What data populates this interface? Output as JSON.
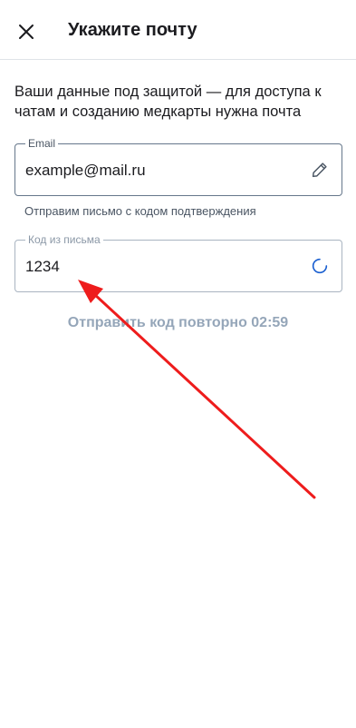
{
  "header": {
    "title": "Укажите почту",
    "close_icon": "close-icon"
  },
  "intro_text": "Ваши данные под защитой — для доступа к чатам и созданию медкарты нужна почта",
  "email_field": {
    "label": "Email",
    "value": "example@mail.ru",
    "icon": "pencil-icon",
    "helper": "Отправим письмо с кодом подтверждения"
  },
  "code_field": {
    "label": "Код из письма",
    "value": "1234",
    "icon": "loading-spinner-icon"
  },
  "resend": {
    "label": "Отправить код повторно 02:59"
  },
  "colors": {
    "accent": "#1a5fd0",
    "annotation_arrow": "#ee1c1c",
    "muted_text": "#95a6b9"
  }
}
